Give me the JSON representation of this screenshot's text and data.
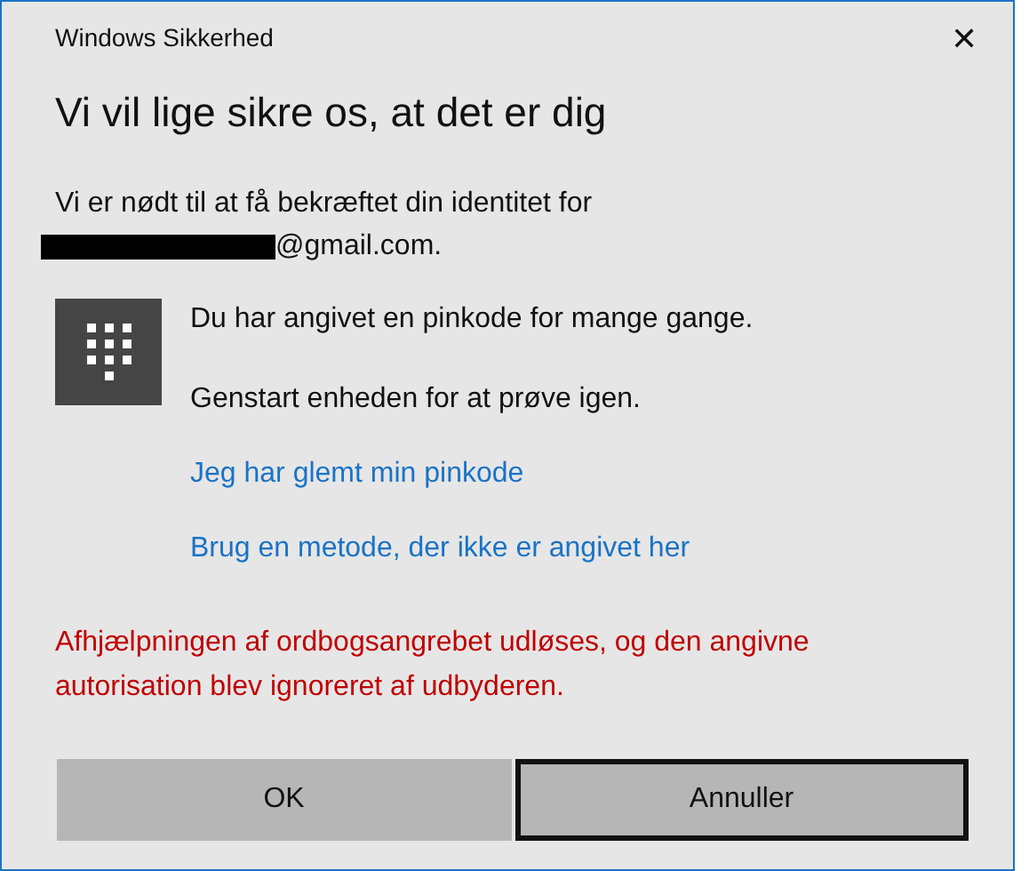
{
  "window": {
    "title": "Windows Sikkerhed",
    "close": "✕"
  },
  "heading": "Vi vil lige sikre os, at det er dig",
  "intro": {
    "text": "Vi er nødt til at få bekræftet din identitet for",
    "email": "@gmail.com.",
    "redacted": true
  },
  "messages": [
    "Du har angivet en pinkode for mange gange.",
    "Genstart enheden for at prøve igen."
  ],
  "links": [
    "Jeg har glemt min pinkode",
    "Brug en metode, der ikke er angivet her"
  ],
  "error": "Afhjælpningen af ordbogsangrebet udløses, og den angivne autorisation blev ignoreret af udbyderen.",
  "buttons": [
    {
      "label": "OK",
      "focused": false
    },
    {
      "label": "Annuller",
      "focused": true
    }
  ]
}
